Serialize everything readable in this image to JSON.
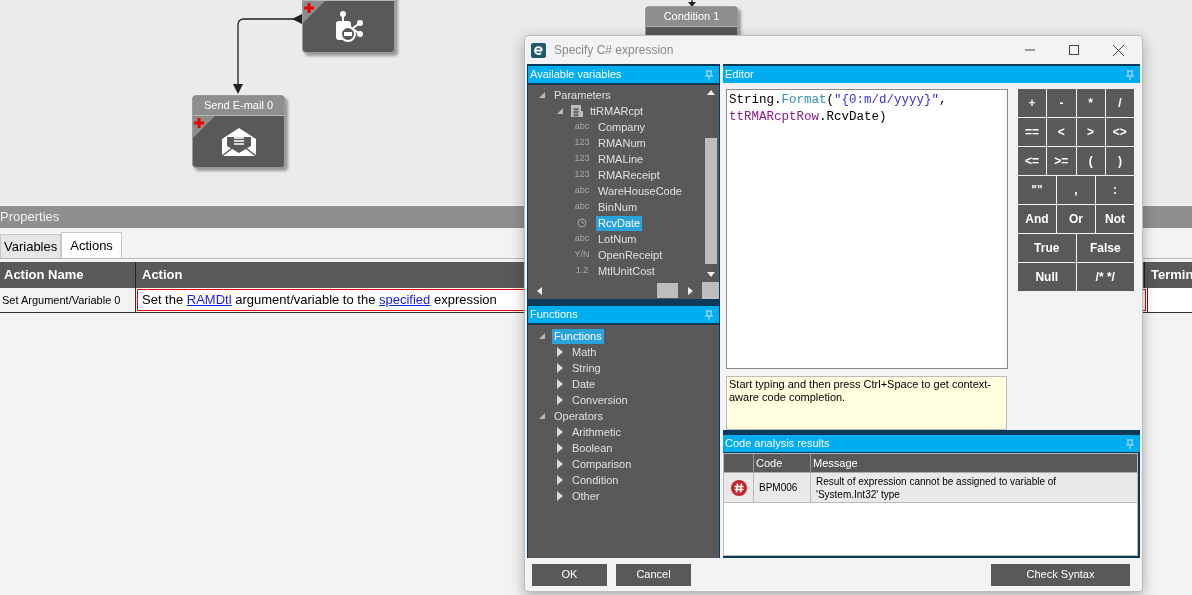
{
  "canvas": {
    "nodes": [
      {
        "kind": "invoke"
      },
      {
        "kind": "condition",
        "title": "Condition 1"
      },
      {
        "kind": "email",
        "title": "Send E-mail 0"
      }
    ]
  },
  "properties": {
    "title": "Properties",
    "tabs": [
      {
        "label": "Variables",
        "selected": false
      },
      {
        "label": "Actions",
        "selected": true
      }
    ],
    "columns": [
      "Action Name",
      "Action",
      "Termin"
    ],
    "rows": [
      {
        "name": "Set Argument/Variable 0",
        "action": [
          {
            "kind": "text",
            "text": "Set the "
          },
          {
            "kind": "link",
            "text": "RAMDtl"
          },
          {
            "kind": "text",
            "text": " argument/variable to the "
          },
          {
            "kind": "link",
            "text": "specified"
          },
          {
            "kind": "text",
            "text": " expression"
          }
        ]
      }
    ]
  },
  "dialog": {
    "title": "Specify C# expression",
    "variables_panel": {
      "title": "Available variables",
      "tree": [
        {
          "kind": "group",
          "label": "Parameters",
          "expanded": true,
          "selected": false,
          "children": [
            {
              "kind": "table",
              "label": "ttRMARcpt",
              "expanded": true,
              "selected": false,
              "children": [
                {
                  "kind": "field",
                  "badge": "abc",
                  "label": "Company",
                  "selected": false
                },
                {
                  "kind": "field",
                  "badge": "123",
                  "label": "RMANum",
                  "selected": false
                },
                {
                  "kind": "field",
                  "badge": "123",
                  "label": "RMALine",
                  "selected": false
                },
                {
                  "kind": "field",
                  "badge": "123",
                  "label": "RMAReceipt",
                  "selected": false
                },
                {
                  "kind": "field",
                  "badge": "abc",
                  "label": "WareHouseCode",
                  "selected": false
                },
                {
                  "kind": "field",
                  "badge": "abc",
                  "label": "BinNum",
                  "selected": false
                },
                {
                  "kind": "date",
                  "label": "RcvDate",
                  "selected": true
                },
                {
                  "kind": "field",
                  "badge": "abc",
                  "label": "LotNum",
                  "selected": false
                },
                {
                  "kind": "field",
                  "badge": "Y/N",
                  "label": "OpenReceipt",
                  "selected": false
                },
                {
                  "kind": "field",
                  "badge": "1.2",
                  "label": "MtlUnitCost",
                  "selected": false
                }
              ]
            }
          ]
        }
      ]
    },
    "functions_panel": {
      "title": "Functions",
      "tree": [
        {
          "kind": "group",
          "label": "Functions",
          "expanded": true,
          "selected": true,
          "children": [
            {
              "kind": "group",
              "label": "Math",
              "expanded": false,
              "selected": false
            },
            {
              "kind": "group",
              "label": "String",
              "expanded": false,
              "selected": false
            },
            {
              "kind": "group",
              "label": "Date",
              "expanded": false,
              "selected": false
            },
            {
              "kind": "group",
              "label": "Conversion",
              "expanded": false,
              "selected": false
            }
          ]
        },
        {
          "kind": "group",
          "label": "Operators",
          "expanded": true,
          "selected": false,
          "children": [
            {
              "kind": "group",
              "label": "Arithmetic",
              "expanded": false,
              "selected": false
            },
            {
              "kind": "group",
              "label": "Boolean",
              "expanded": false,
              "selected": false
            },
            {
              "kind": "group",
              "label": "Comparison",
              "expanded": false,
              "selected": false
            },
            {
              "kind": "group",
              "label": "Condition",
              "expanded": false,
              "selected": false
            },
            {
              "kind": "group",
              "label": "Other",
              "expanded": false,
              "selected": false
            }
          ]
        }
      ]
    },
    "editor": {
      "title": "Editor",
      "lines": [
        [
          {
            "kind": "plain",
            "text": "String."
          },
          {
            "kind": "method",
            "text": "Format"
          },
          {
            "kind": "plain",
            "text": "("
          },
          {
            "kind": "string",
            "text": "\"{0:m/d/yyyy}\""
          },
          {
            "kind": "plain",
            "text": ","
          }
        ],
        [
          {
            "kind": "variable",
            "text": "ttRMARcptRow"
          },
          {
            "kind": "plain",
            "text": ".RcvDate)"
          }
        ]
      ]
    },
    "operators": [
      [
        "+",
        "-",
        "*",
        "/"
      ],
      [
        "==",
        "<",
        ">",
        "<>"
      ],
      [
        "<=",
        ">=",
        "(",
        ")"
      ],
      [
        "\"\"",
        ",",
        ":"
      ],
      [
        "And",
        "Or",
        "Not"
      ],
      [
        "True",
        "False"
      ],
      [
        "Null",
        "/* */"
      ]
    ],
    "hint": "Start typing and then press Ctrl+Space to get context-aware code completion.",
    "analysis": {
      "title": "Code analysis results",
      "columns": [
        "Code",
        "Message"
      ],
      "rows": [
        {
          "kind": "error",
          "code": "BPM006",
          "message": "Result of expression cannot be assigned to variable of 'System.Int32' type"
        }
      ]
    },
    "buttons": [
      "OK",
      "Cancel"
    ],
    "check_button": "Check Syntax"
  }
}
